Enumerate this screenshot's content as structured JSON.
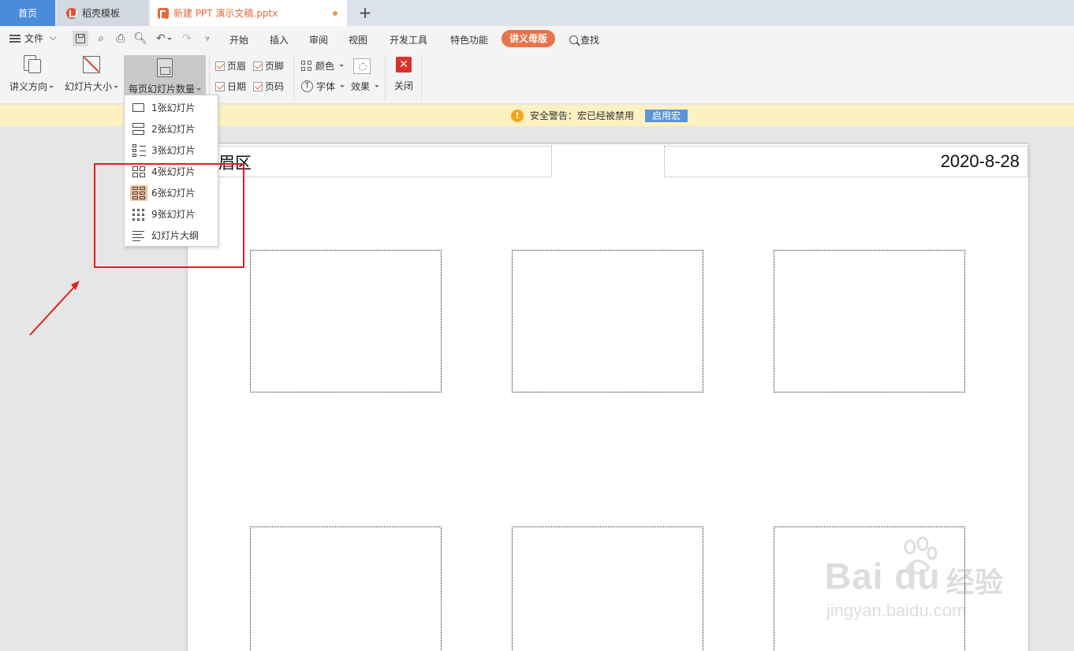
{
  "tabs": {
    "home": "首页",
    "template": "稻壳模板",
    "document": "新建 PPT 演示文稿.pptx",
    "new_tab": "+"
  },
  "menubar": {
    "file": "文件",
    "items": [
      "开始",
      "插入",
      "审阅",
      "视图",
      "开发工具",
      "特色功能"
    ],
    "active": "讲义母版",
    "search": "查找"
  },
  "ribbon": {
    "orientation": "讲义方向",
    "slide_size": "幻灯片大小",
    "slides_per_page": "每页幻灯片数量",
    "header": "页眉",
    "footer": "页脚",
    "date": "日期",
    "page_number": "页码",
    "color": "颜色",
    "font": "字体",
    "effect": "效果",
    "close": "关闭"
  },
  "security": {
    "message": "安全警告：宏已经被禁用",
    "button": "启用宏"
  },
  "handout": {
    "header_text": "眉区",
    "date_text": "2020-8-28"
  },
  "dropdown": {
    "items": [
      "1张幻灯片",
      "2张幻灯片",
      "3张幻灯片",
      "4张幻灯片",
      "6张幻灯片",
      "9张幻灯片",
      "幻灯片大纲"
    ],
    "selected_index": 4
  },
  "watermark": {
    "brand": "Bai du",
    "cn": "经验",
    "url": "jingyan.baidu.com"
  },
  "colors": {
    "accent": "#e8734a",
    "home_tab": "#4a8bdc",
    "annotation": "#e02020"
  }
}
